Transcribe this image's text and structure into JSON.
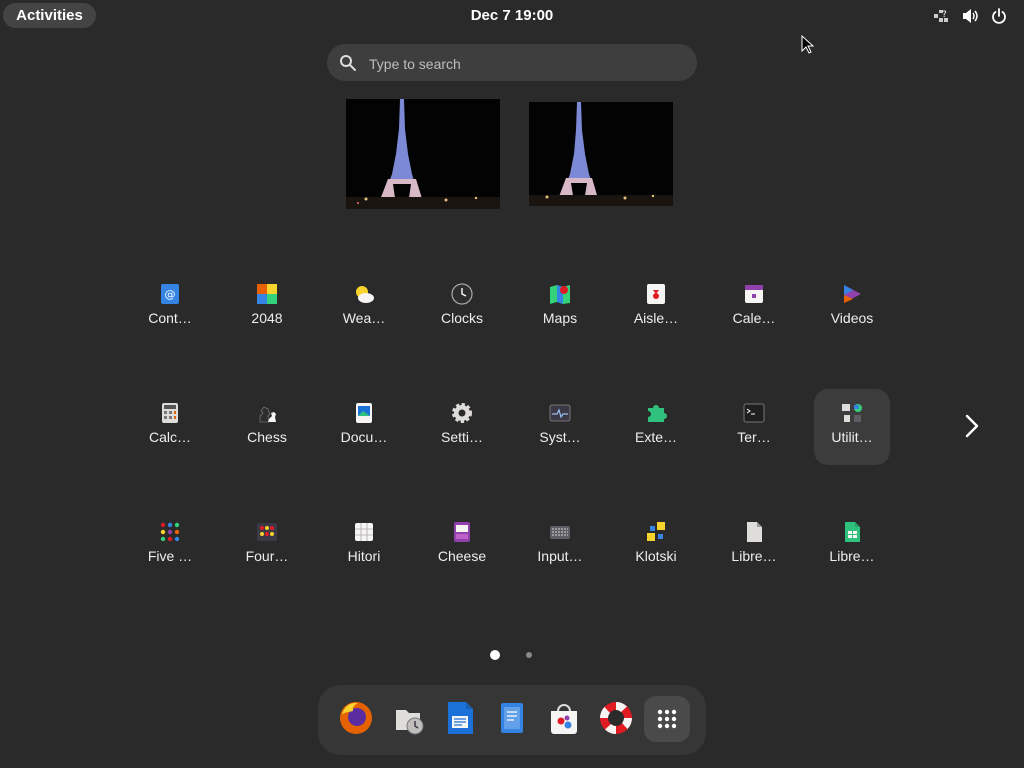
{
  "topbar": {
    "activities_label": "Activities",
    "clock": "Dec 7  19:00",
    "indicators": [
      "network-question-icon",
      "volume-icon",
      "power-icon"
    ]
  },
  "search": {
    "placeholder": "Type to search"
  },
  "workspaces": [
    "eiffel-tower-night-wallpaper",
    "eiffel-tower-night-wallpaper"
  ],
  "apps": [
    [
      "Cont…",
      "2048",
      "Wea…",
      "Clocks",
      "Maps",
      "Aisle…",
      "Cale…",
      "Videos"
    ],
    [
      "Calc…",
      "Chess",
      "Docu…",
      "Setti…",
      "Syst…",
      "Exte…",
      "Ter…",
      "Utilit…"
    ],
    [
      "Five …",
      "Four…",
      "Hitori",
      "Cheese",
      "Input…",
      "Klotski",
      "Libre…",
      "Libre…"
    ]
  ],
  "app_icons": [
    [
      "contacts-icon",
      "2048-icon",
      "weather-icon",
      "clocks-icon",
      "maps-icon",
      "aisleriot-icon",
      "calendar-icon",
      "videos-icon"
    ],
    [
      "calculator-icon",
      "chess-icon",
      "document-viewer-icon",
      "settings-icon",
      "system-monitor-icon",
      "extensions-icon",
      "terminal-icon",
      "utilities-folder-icon"
    ],
    [
      "five-or-more-icon",
      "four-in-a-row-icon",
      "hitori-icon",
      "cheese-icon",
      "input-method-icon",
      "klotski-icon",
      "libreoffice-icon",
      "libreoffice-calc-icon"
    ]
  ],
  "pagination": {
    "pages": 2,
    "current": 1
  },
  "dash": [
    "firefox-icon",
    "backups-icon",
    "libreoffice-writer-icon",
    "text-editor-icon",
    "software-icon",
    "help-icon",
    "show-apps-icon"
  ],
  "colors": {
    "background": "#2a2a2a",
    "panel": "#363636",
    "activities": "#444444"
  }
}
